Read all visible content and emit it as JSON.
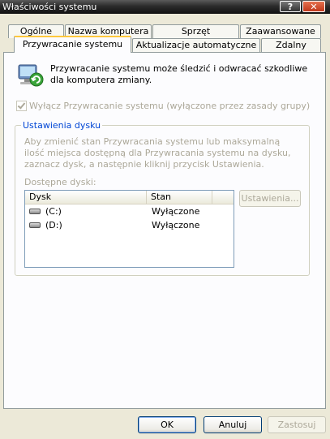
{
  "window": {
    "title": "Właściwości systemu",
    "help_label": "?",
    "close_label": "✕"
  },
  "tabs": {
    "row1": [
      "Ogólne",
      "Nazwa komputera",
      "Sprzęt",
      "Zaawansowane"
    ],
    "row2": [
      "Przywracanie systemu",
      "Aktualizacje automatyczne",
      "Zdalny"
    ],
    "active": "Przywracanie systemu"
  },
  "intro": {
    "icon": "system-restore-icon",
    "text": "Przywracanie systemu może śledzić i odwracać szkodliwe dla komputera zmiany."
  },
  "disable_checkbox": {
    "label": "Wyłącz Przywracanie systemu (wyłączone przez zasady grupy)",
    "checked": true,
    "enabled": false
  },
  "disk_settings": {
    "legend": "Ustawienia dysku",
    "description": "Aby zmienić stan Przywracania systemu lub maksymalną ilość miejsca dostępną dla Przywracania systemu na dysku, zaznacz dysk, a następnie kliknij przycisk Ustawienia.",
    "drives_label": "Dostępne dyski:",
    "columns": [
      "Dysk",
      "Stan"
    ],
    "rows": [
      {
        "drive": "(C:)",
        "status": "Wyłączone",
        "icon": "hard-drive-icon"
      },
      {
        "drive": "(D:)",
        "status": "Wyłączone",
        "icon": "hard-drive-icon"
      }
    ],
    "settings_button": "Ustawienia..."
  },
  "footer": {
    "ok": "OK",
    "cancel": "Anuluj",
    "apply": "Zastosuj"
  },
  "colors": {
    "face": "#ECE9D8",
    "panel": "#FCFCFE",
    "legend": "#0046D5",
    "disabled_text": "#ACA899",
    "active_tab_accent": "#FFC83C"
  }
}
